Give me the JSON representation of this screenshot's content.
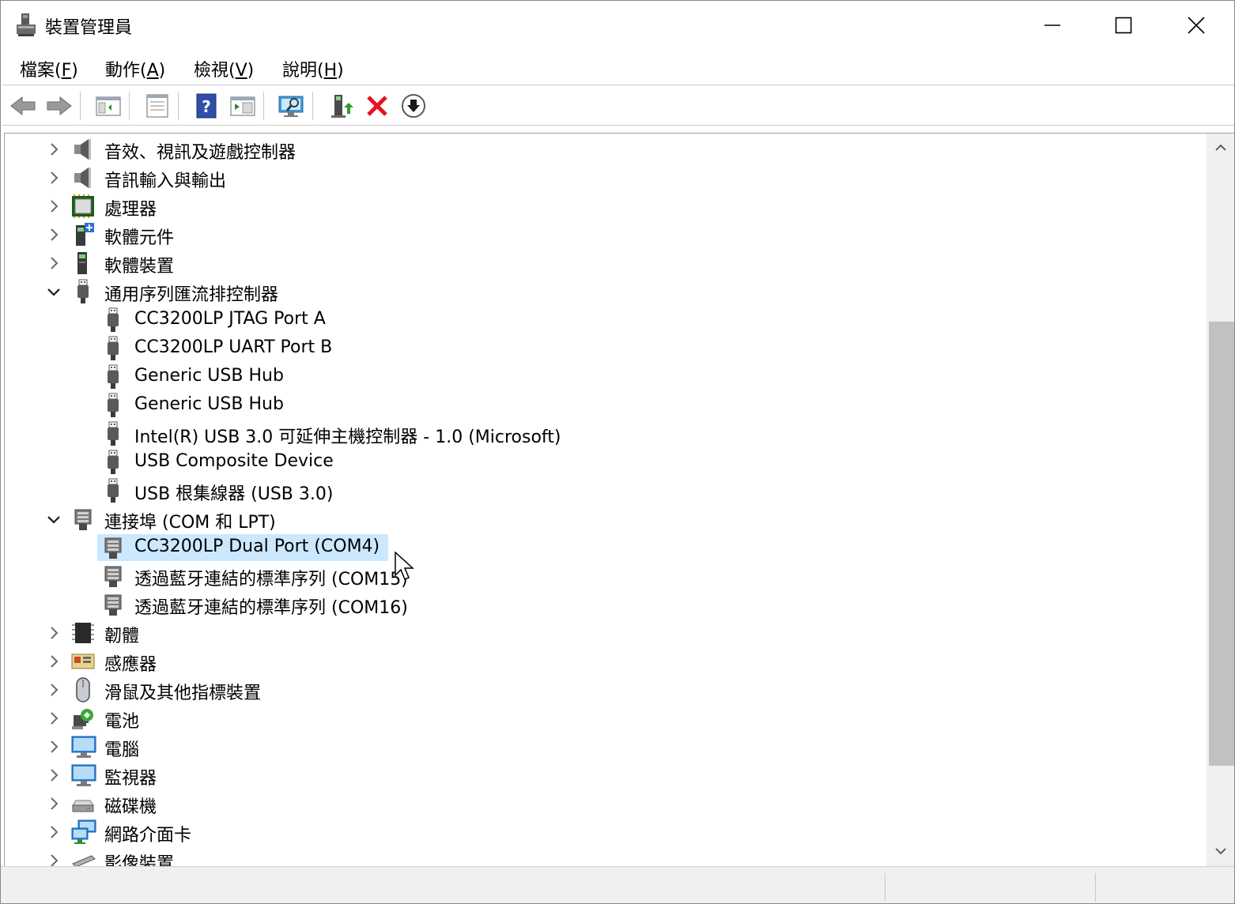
{
  "window": {
    "title": "裝置管理員"
  },
  "menu": {
    "file": {
      "label": "檔案(",
      "accel": "F",
      "end": ")"
    },
    "action": {
      "label": "動作(",
      "accel": "A",
      "end": ")"
    },
    "view": {
      "label": "檢視(",
      "accel": "V",
      "end": ")"
    },
    "help": {
      "label": "說明(",
      "accel": "H",
      "end": ")"
    }
  },
  "toolbar": {
    "icons": [
      "back-arrow-icon",
      "forward-arrow-icon",
      "show-hide-console-tree-icon",
      "properties-icon",
      "help-icon",
      "run-icon",
      "scan-hardware-icon",
      "update-driver-icon",
      "uninstall-icon",
      "download-icon"
    ]
  },
  "tree": {
    "items": [
      {
        "label": "音效、視訊及遊戲控制器",
        "expanded": false,
        "icon": "speaker-icon"
      },
      {
        "label": "音訊輸入與輸出",
        "expanded": false,
        "icon": "speaker-icon"
      },
      {
        "label": "處理器",
        "expanded": false,
        "icon": "processor-chip-icon"
      },
      {
        "label": "軟體元件",
        "expanded": false,
        "icon": "software-component-icon"
      },
      {
        "label": "軟體裝置",
        "expanded": false,
        "icon": "software-device-icon"
      },
      {
        "label": "通用序列匯流排控制器",
        "expanded": true,
        "icon": "usb-connector-icon"
      },
      {
        "label": "CC3200LP JTAG Port A",
        "child": true,
        "icon": "usb-connector-icon"
      },
      {
        "label": "CC3200LP UART Port B",
        "child": true,
        "icon": "usb-connector-icon"
      },
      {
        "label": "Generic USB Hub",
        "child": true,
        "icon": "usb-connector-icon"
      },
      {
        "label": "Generic USB Hub",
        "child": true,
        "icon": "usb-connector-icon"
      },
      {
        "label": "Intel(R) USB 3.0 可延伸主機控制器 - 1.0 (Microsoft)",
        "child": true,
        "icon": "usb-connector-icon"
      },
      {
        "label": "USB Composite Device",
        "child": true,
        "icon": "usb-connector-icon"
      },
      {
        "label": "USB 根集線器 (USB 3.0)",
        "child": true,
        "icon": "usb-connector-icon"
      },
      {
        "label": "連接埠 (COM 和 LPT)",
        "expanded": true,
        "icon": "port-connector-icon"
      },
      {
        "label": "CC3200LP Dual Port (COM4)",
        "child": true,
        "selected": true,
        "icon": "port-connector-icon"
      },
      {
        "label": "透過藍牙連結的標準序列 (COM15)",
        "child": true,
        "icon": "port-connector-icon"
      },
      {
        "label": "透過藍牙連結的標準序列 (COM16)",
        "child": true,
        "icon": "port-connector-icon"
      },
      {
        "label": "韌體",
        "expanded": false,
        "icon": "firmware-chip-icon"
      },
      {
        "label": "感應器",
        "expanded": false,
        "icon": "sensor-icon"
      },
      {
        "label": "滑鼠及其他指標裝置",
        "expanded": false,
        "icon": "mouse-icon"
      },
      {
        "label": "電池",
        "expanded": false,
        "icon": "battery-icon"
      },
      {
        "label": "電腦",
        "expanded": false,
        "icon": "computer-monitor-icon"
      },
      {
        "label": "監視器",
        "expanded": false,
        "icon": "computer-monitor-icon"
      },
      {
        "label": "磁碟機",
        "expanded": false,
        "icon": "disk-drive-icon"
      },
      {
        "label": "網路介面卡",
        "expanded": false,
        "icon": "network-adapter-icon"
      },
      {
        "label": "影像裝置",
        "expanded": false,
        "icon": "imaging-device-icon"
      }
    ]
  },
  "colors": {
    "selection": "#cce8ff",
    "scroll_thumb": "#c1c1c1",
    "uninstall_red": "#e81123"
  }
}
